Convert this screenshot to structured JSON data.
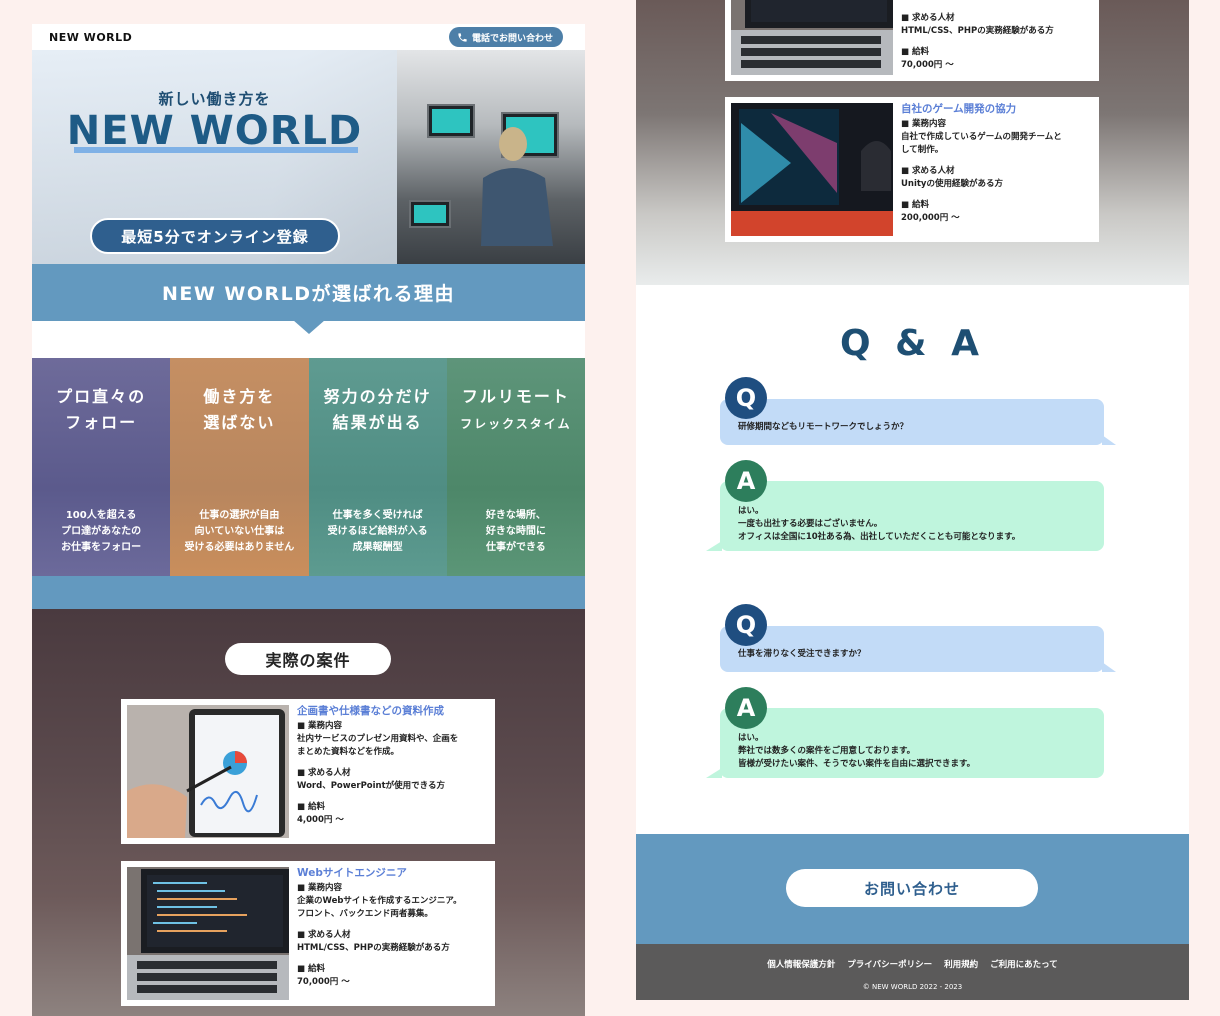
{
  "header": {
    "logo": "NEW WORLD",
    "phone_button": "電話でお問い合わせ"
  },
  "hero": {
    "subtitle": "新しい働き方を",
    "title": "NEW WORLD",
    "cta": "最短5分でオンライン登録"
  },
  "reasons": {
    "heading": "NEW WORLDが選ばれる理由",
    "cards": [
      {
        "title_1": "プロ直々の",
        "title_2": "フォロー",
        "text_1": "100人を超える",
        "text_2": "プロ達があなたの",
        "text_3": "お仕事をフォロー"
      },
      {
        "title_1": "働き方を",
        "title_2": "選ばない",
        "text_1": "仕事の選択が自由",
        "text_2": "向いていない仕事は",
        "text_3": "受ける必要はありません"
      },
      {
        "title_1": "努力の分だけ",
        "title_2": "結果が出る",
        "text_1": "仕事を多く受ければ",
        "text_2": "受けるほど給料が入る",
        "text_3": "成果報酬型"
      },
      {
        "title_1": "フルリモート",
        "title_2": "フレックスタイム",
        "text_1": "好きな場所、",
        "text_2": "好きな時間に",
        "text_3": "仕事ができる"
      }
    ]
  },
  "jobs": {
    "heading": "実際の案件",
    "items": [
      {
        "title": "企画書や仕様書などの資料作成",
        "duty_label": "■ 業務内容",
        "duty_1": "社内サービスのプレゼン用資料や、企画を",
        "duty_2": "まとめた資料などを作成。",
        "req_label": "■ 求める人材",
        "req_1": "Word、PowerPointが使用できる方",
        "salary_label": "■ 給料",
        "salary": "4,000円 〜"
      },
      {
        "title": "Webサイトエンジニア",
        "duty_label": "■ 業務内容",
        "duty_1": "企業のWebサイトを作成するエンジニア。",
        "duty_2": "フロント、バックエンド両者募集。",
        "req_label": "■ 求める人材",
        "req_1": "HTML/CSS、PHPの実務経験がある方",
        "salary_label": "■ 給料",
        "salary": "70,000円 〜"
      },
      {
        "title": "自社のゲーム開発の協力",
        "duty_label": "■ 業務内容",
        "duty_1": "自社で作成しているゲームの開発チームと",
        "duty_2": "して制作。",
        "req_label": "■ 求める人材",
        "req_1": "Unityの使用経験がある方",
        "salary_label": "■ 給料",
        "salary": "200,000円 〜"
      }
    ]
  },
  "qa": {
    "heading": "Q & A",
    "q_badge": "Q",
    "a_badge": "A",
    "items": [
      {
        "question": "研修期間などもリモートワークでしょうか？",
        "answer_1": "はい。",
        "answer_2": "一度も出社する必要はございません。",
        "answer_3": "オフィスは全国に10社ある為、出社していただくことも可能となります。"
      },
      {
        "question": "仕事を滞りなく受注できますか？",
        "answer_1": "はい。",
        "answer_2": "弊社では数多くの案件をご用意しております。",
        "answer_3": "皆様が受けたい案件、そうでない案件を自由に選択できます。"
      }
    ]
  },
  "contact": {
    "button": "お問い合わせ"
  },
  "footer": {
    "links": [
      "個人情報保護方針",
      "プライバシーポリシー",
      "利用規約",
      "ご利用にあたって"
    ],
    "copyright": "© NEW WORLD 2022 - 2023"
  },
  "colors": {
    "accent": "#6399bf",
    "dark_blue": "#1e5b86",
    "question": "#c2dbf7",
    "answer": "#bff5dd",
    "job_title": "#5b7fd6"
  }
}
